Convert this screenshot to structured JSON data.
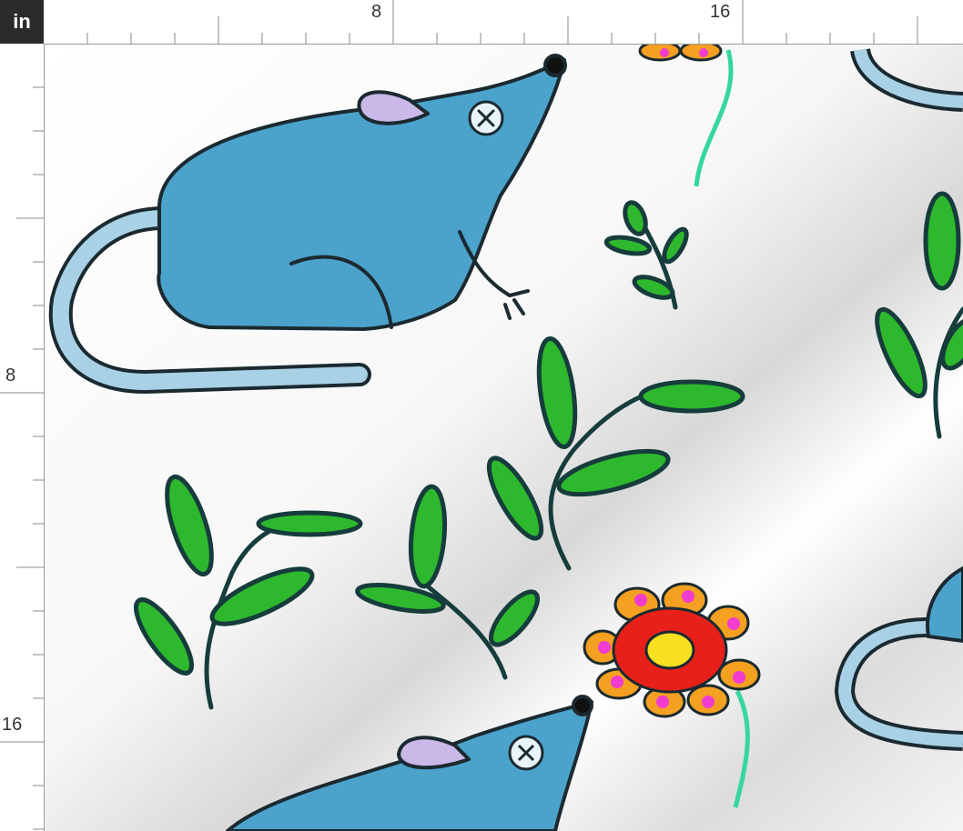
{
  "ruler": {
    "unit_label": "in",
    "top_labels": [
      "8",
      "16"
    ],
    "left_labels": [
      "8",
      "16"
    ]
  },
  "fabric": {
    "motifs": [
      "mouse",
      "leaf-sprig",
      "flower"
    ],
    "colors": {
      "mouse_body": "#4ba3cc",
      "mouse_tail": "#a9d1e6",
      "mouse_ear": "#c9b8e8",
      "outline": "#1b2a30",
      "leaf": "#2eb82e",
      "flower_petal": "#f4a020",
      "flower_center": "#e8201a",
      "flower_dot": "#f03ccf",
      "flower_eye": "#f7e020",
      "stem": "#35d6a0"
    }
  }
}
